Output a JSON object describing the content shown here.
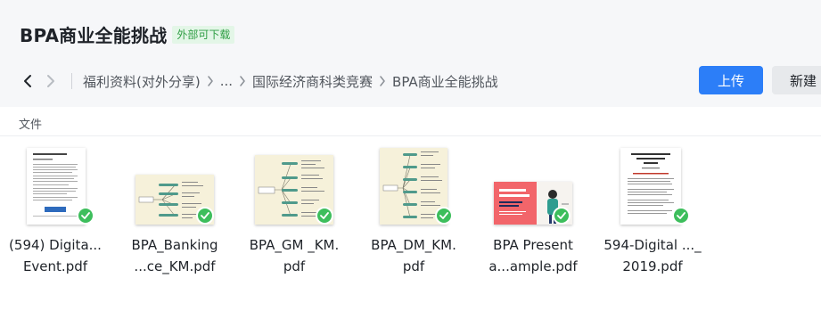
{
  "header": {
    "title": "BPA商业全能挑战",
    "badge": "外部可下载"
  },
  "breadcrumb": {
    "items": [
      "福利资料(对外分享)",
      "...",
      "国际经济商科类竞赛",
      "BPA商业全能挑战"
    ]
  },
  "toolbar": {
    "upload_label": "上传",
    "new_label": "新建"
  },
  "section": {
    "label": "文件"
  },
  "files": [
    {
      "line1": "(594) Digita...",
      "line2": "Event.pdf",
      "synced": true
    },
    {
      "line1": "BPA_Banking",
      "line2": "...ce_KM.pdf",
      "synced": true
    },
    {
      "line1": "BPA_GM _KM.",
      "line2": "pdf",
      "synced": true
    },
    {
      "line1": "BPA_DM_KM.",
      "line2": "pdf",
      "synced": true
    },
    {
      "line1": "BPA Present",
      "line2": "a...ample.pdf",
      "synced": true
    },
    {
      "line1": "594-Digital ..._",
      "line2": "2019.pdf",
      "synced": true
    }
  ],
  "thumbnails": {
    "slide_title": "Return To Work Policy",
    "slide_subtitle": "Digital Solutions",
    "doc_title": "DIGITAL MARKETING CONCEPTS (594)",
    "mindmap_bg": "#f6f1da",
    "mindmap_node": "#4f9a8b",
    "slide_bg": "#f2656a"
  },
  "colors": {
    "accent": "#2c7ef8",
    "success": "#3dbe5c",
    "badge_text": "#2f9e44",
    "badge_bg": "#e3f6e7"
  }
}
